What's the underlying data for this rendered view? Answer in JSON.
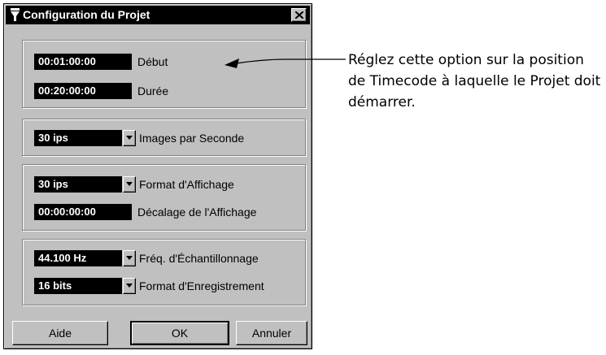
{
  "window": {
    "title": "Configuration du Projet",
    "close_glyph": "X"
  },
  "groups": {
    "timecode": {
      "start_value": "00:01:00:00",
      "start_label": "Début",
      "length_value": "00:20:00:00",
      "length_label": "Durée"
    },
    "frame_rate": {
      "value": "30 ips",
      "label": "Images par Seconde"
    },
    "display": {
      "format_value": "30 ips",
      "format_label": "Format d'Affichage",
      "offset_value": "00:00:00:00",
      "offset_label": "Décalage de l'Affichage"
    },
    "audio": {
      "sample_rate_value": "44.100 Hz",
      "sample_rate_label": "Fréq. d'Échantillonnage",
      "record_format_value": "16 bits",
      "record_format_label": "Format d'Enregistrement"
    }
  },
  "buttons": {
    "help": "Aide",
    "ok": "OK",
    "cancel": "Annuler"
  },
  "callout": {
    "text": "Réglez cette option sur la position de Timecode à laquelle le Projet doit démarrer."
  }
}
